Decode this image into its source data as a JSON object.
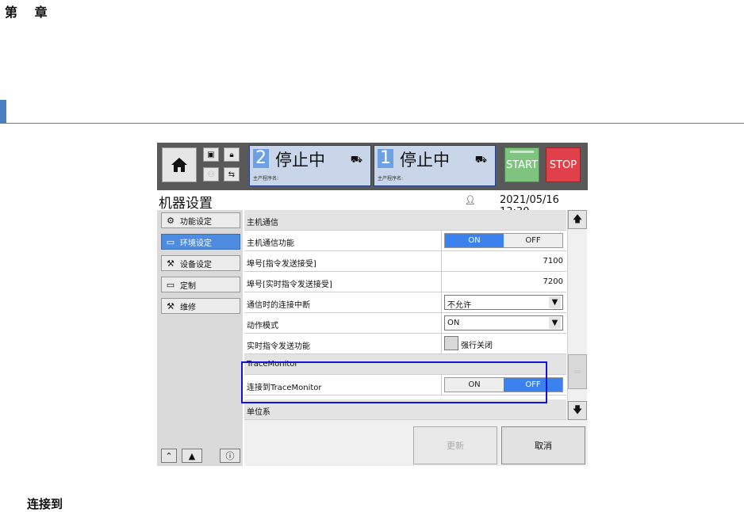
{
  "doc": {
    "chapter": "第 章",
    "caption": "连接到"
  },
  "hmi": {
    "header": {
      "status_panels": [
        {
          "number": "2",
          "state": "停止中",
          "program_label": "主产程序名:"
        },
        {
          "number": "1",
          "state": "停止中",
          "program_label": "主产程序名:"
        }
      ],
      "start_label": "START",
      "stop_label": "STOP"
    },
    "title": "机器设置",
    "datetime": "2021/05/16 13:30",
    "sidebar": {
      "items": [
        {
          "label": "功能设定",
          "icon": "gear-cog-icon",
          "active": false
        },
        {
          "label": "环境设定",
          "icon": "monitor-settings-icon",
          "active": true
        },
        {
          "label": "设备设定",
          "icon": "device-settings-icon",
          "active": false
        },
        {
          "label": "定制",
          "icon": "customize-icon",
          "active": false
        },
        {
          "label": "维修",
          "icon": "maintenance-icon",
          "active": false
        }
      ]
    },
    "settings": {
      "section_host": "主机通信",
      "host_func_label": "主机通信功能",
      "port_cmd_label": "埠号[指令发送接受]",
      "port_cmd_value": "7100",
      "port_rt_label": "埠号[实时指令发送接受]",
      "port_rt_value": "7200",
      "disconnect_label": "通信时的连接中断",
      "disconnect_value": "不允许",
      "mode_label": "动作模式",
      "mode_value": "ON",
      "rt_send_label": "实时指令发送功能",
      "rt_send_check_label": "强行关闭",
      "section_trace": "TraceMonitor",
      "trace_connect_label": "连接到TraceMonitor",
      "section_unit": "单位系",
      "on_label": "ON",
      "off_label": "OFF"
    },
    "footer": {
      "update_label": "更新",
      "cancel_label": "取消"
    },
    "colors": {
      "active_blue": "#3b82ef",
      "start_green": "#7ec47e",
      "stop_red": "#e0404a",
      "highlight_box": "#1414d6"
    }
  }
}
